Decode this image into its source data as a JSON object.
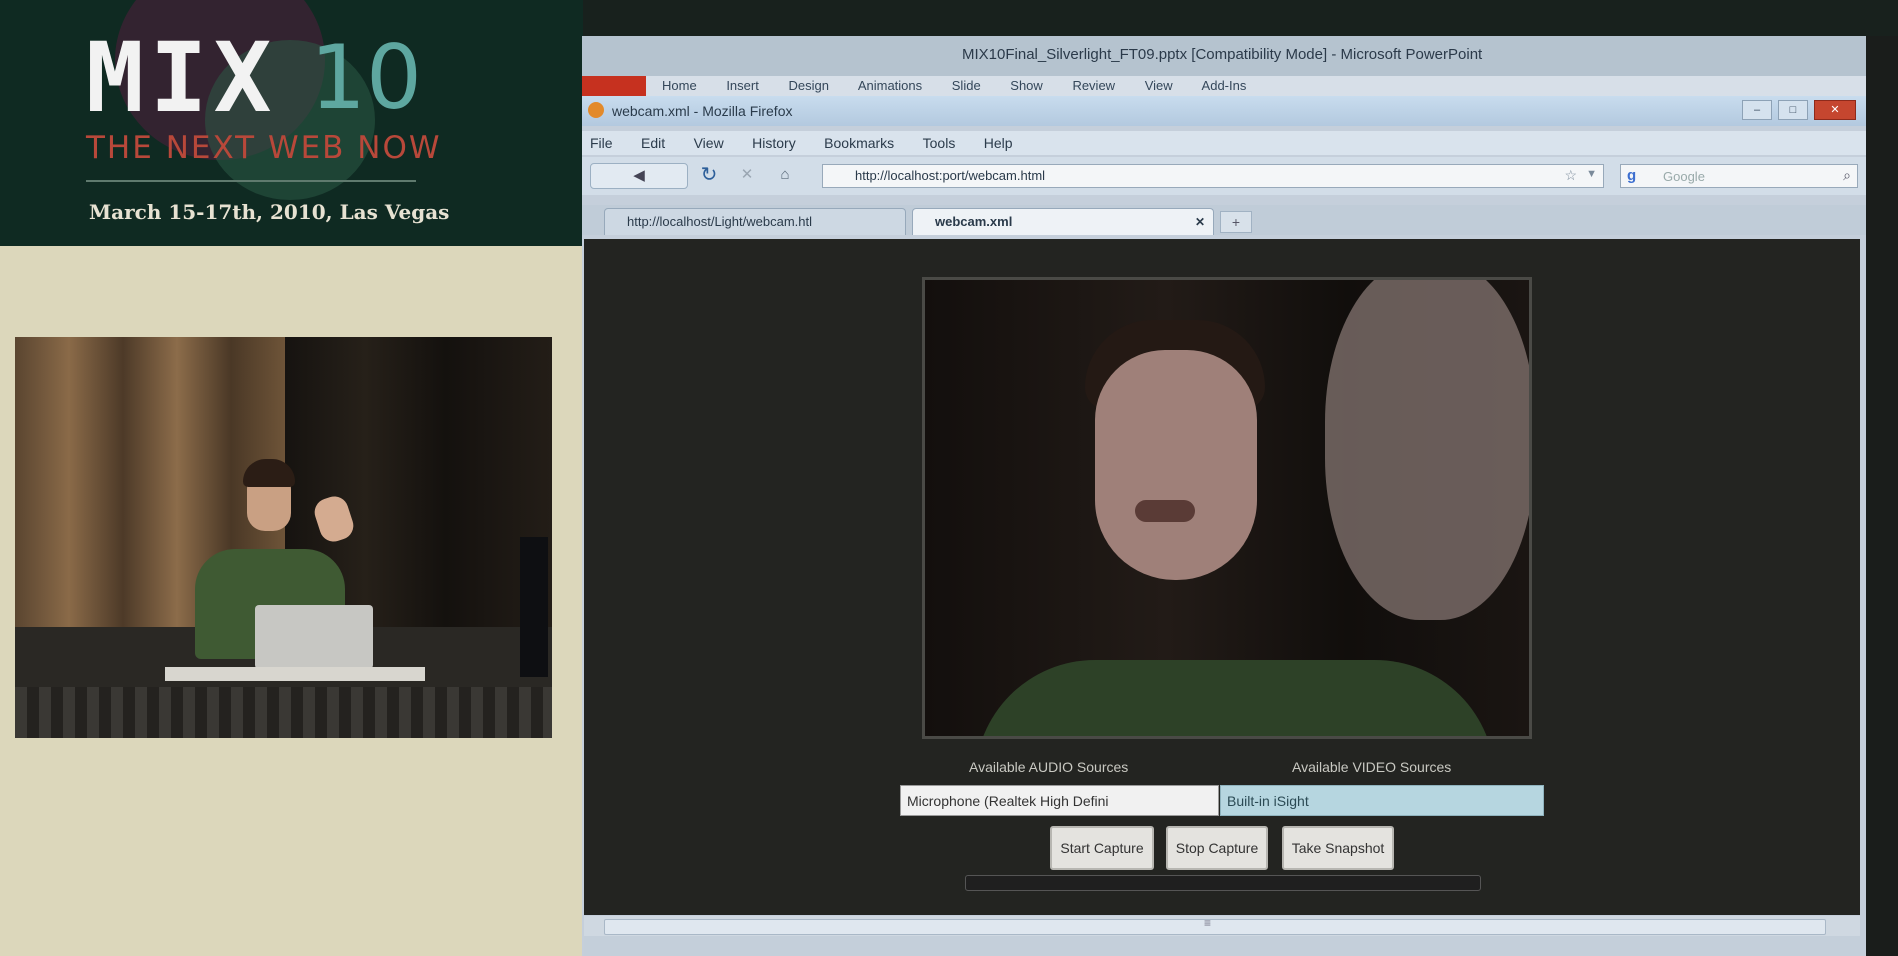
{
  "event": {
    "logo_text": "MIX",
    "logo_number": "10",
    "tagline": "THE NEXT WEB NOW",
    "date": "March 15-17th, 2010, Las Vegas"
  },
  "presentation_window": {
    "title": "MIX10Final_Silverlight_FT09.pptx [Compatibility Mode] - Microsoft PowerPoint",
    "ribbon_tabs": [
      "Home",
      "Insert",
      "Design",
      "Animations",
      "Slide Show",
      "Review",
      "View",
      "Add-Ins"
    ]
  },
  "browser": {
    "title": "webcam.xml - Mozilla Firefox",
    "menu": [
      "File",
      "Edit",
      "View",
      "History",
      "Bookmarks",
      "Tools",
      "Help"
    ],
    "url": "http://localhost:port/webcam.html",
    "search_placeholder": "Google",
    "tabs": [
      {
        "title": "http://localhost/Light/webcam.htl"
      },
      {
        "title": "webcam.xml"
      }
    ],
    "window_buttons": {
      "minimize": "–",
      "maximize": "□",
      "close": "✕"
    }
  },
  "webcam_app": {
    "audio_label": "Available AUDIO Sources",
    "video_label": "Available VIDEO Sources",
    "audio_source": "Microphone (Realtek High Defini",
    "video_source": "Built-in iSight",
    "buttons": {
      "start": "Start Capture",
      "stop": "Stop Capture",
      "snapshot": "Take Snapshot"
    },
    "progress": 0
  },
  "icons": {
    "back": "back-arrow-icon",
    "reload": "reload-icon",
    "stop": "stop-icon",
    "home": "home-icon",
    "bookmark": "star-icon",
    "search": "magnifier-icon"
  }
}
